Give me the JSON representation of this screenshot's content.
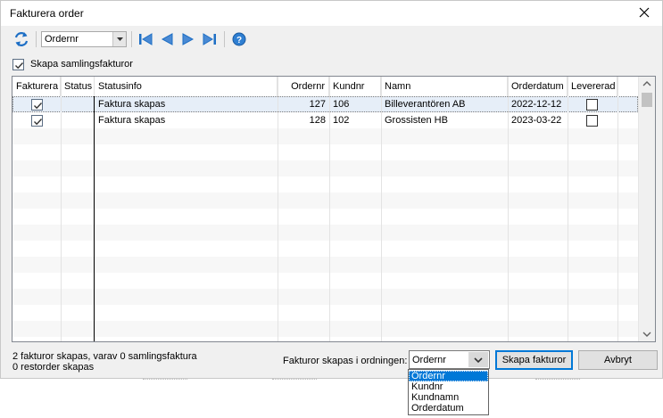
{
  "window": {
    "title": "Fakturera order"
  },
  "toolbar": {
    "sort_value": "Ordernr"
  },
  "samling": {
    "label": "Skapa samlingsfakturor",
    "checked": true
  },
  "grid": {
    "columns": [
      "Fakturera",
      "Status",
      "Statusinfo",
      "Ordernr",
      "Kundnr",
      "Namn",
      "Orderdatum",
      "Levererad"
    ],
    "rows": [
      {
        "fakturera": true,
        "status": "",
        "statusinfo": "Faktura skapas",
        "ordernr": "127",
        "kundnr": "106",
        "namn": "Billeverantören AB",
        "orderdatum": "2022-12-12",
        "levererad": false
      },
      {
        "fakturera": true,
        "status": "",
        "statusinfo": "Faktura skapas",
        "ordernr": "128",
        "kundnr": "102",
        "namn": "Grossisten HB",
        "orderdatum": "2023-03-22",
        "levererad": false
      }
    ]
  },
  "status": {
    "line1": "2 fakturor skapas, varav 0 samlingsfaktura",
    "line2": "0 restorder skapas"
  },
  "order": {
    "label": "Fakturor skapas i ordningen:",
    "value": "Ordernr",
    "options": [
      "Ordernr",
      "Kundnr",
      "Kundnamn",
      "Orderdatum"
    ]
  },
  "buttons": {
    "create": "Skapa fakturor",
    "cancel": "Avbryt"
  },
  "colors": {
    "accent": "#0078d7",
    "icon_blue": "#1e6fc5",
    "selected_row": "#e6eef8"
  }
}
